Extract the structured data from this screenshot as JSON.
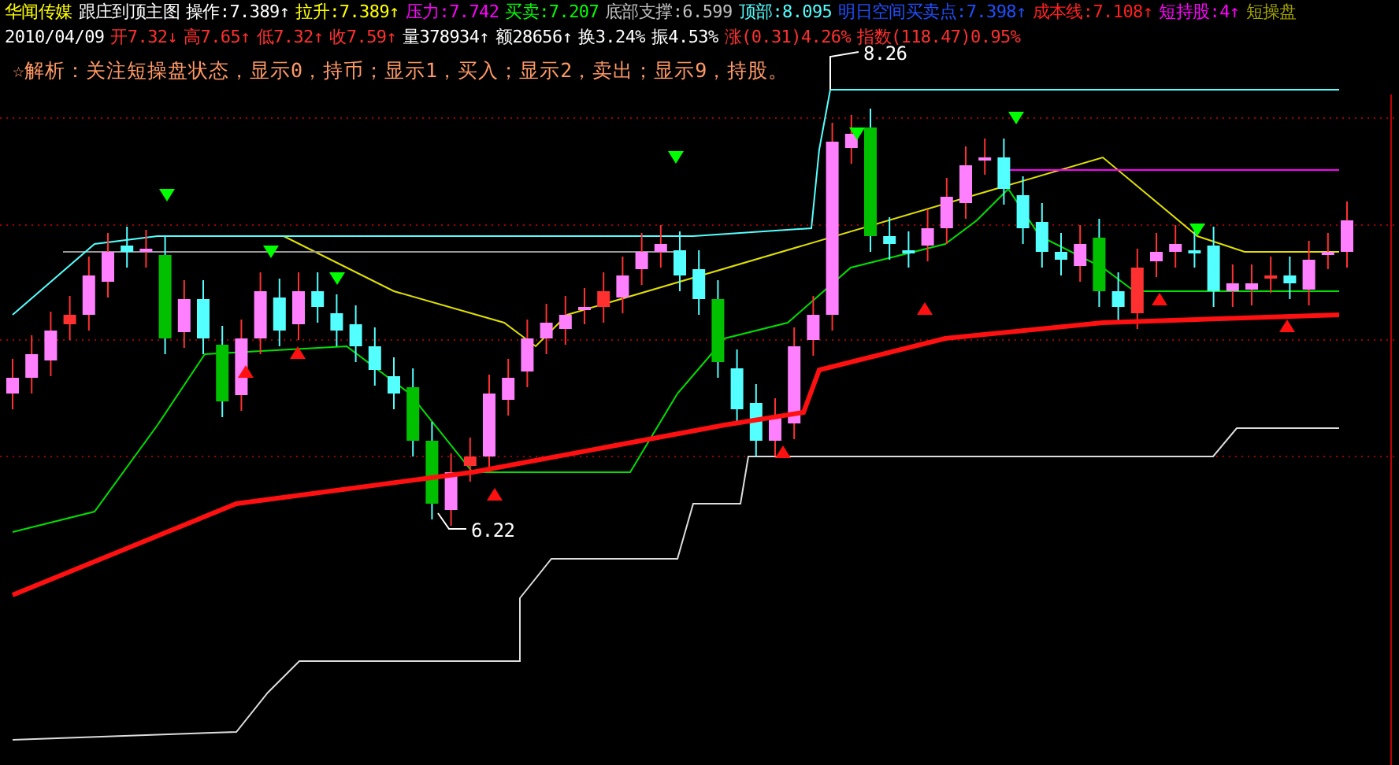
{
  "quote_line": [
    {
      "text": "华闻传媒",
      "color": "#ffff00"
    },
    {
      "text": "跟庄到顶主图",
      "color": "#ffffff"
    },
    {
      "text": "操作:7.389↑",
      "color": "#ffffff"
    },
    {
      "text": "拉升:7.389↑",
      "color": "#ffff00"
    },
    {
      "text": "压力:7.742",
      "color": "#ff00ff"
    },
    {
      "text": "买卖:7.207",
      "color": "#00ff00"
    },
    {
      "text": "底部支撑:6.599",
      "color": "#c0c0c0"
    },
    {
      "text": "顶部:8.095",
      "color": "#54ffff"
    },
    {
      "text": "明日空间买卖点:7.398↑",
      "color": "#2050ff"
    },
    {
      "text": "成本线:7.108↑",
      "color": "#ff2020"
    },
    {
      "text": "短持股:4↑",
      "color": "#ff00ff"
    },
    {
      "text": "短操盘",
      "color": "#a0a000"
    }
  ],
  "price_line": [
    {
      "text": "2010/04/09",
      "color": "#ffffff"
    },
    {
      "text": "开7.32↓",
      "color": "#ff3030"
    },
    {
      "text": "高7.65↑",
      "color": "#ff3030"
    },
    {
      "text": "低7.32↑",
      "color": "#ff3030"
    },
    {
      "text": "收7.59↑",
      "color": "#ff3030"
    },
    {
      "text": "量378934↑",
      "color": "#ffffff"
    },
    {
      "text": "额28656↑",
      "color": "#ffffff"
    },
    {
      "text": "换3.24%",
      "color": "#ffffff"
    },
    {
      "text": "振4.53%",
      "color": "#ffffff"
    },
    {
      "text": "涨(0.31)4.26%",
      "color": "#ff3030"
    },
    {
      "text": "指数(118.47)0.95%",
      "color": "#ff3030"
    }
  ],
  "note": "☆解析：关注短操盘状态，显示0，持币；显示1，买入；显示2，卖出；显示9，持股。",
  "chart": {
    "high_label": "8.26",
    "low_label": "6.22"
  }
}
